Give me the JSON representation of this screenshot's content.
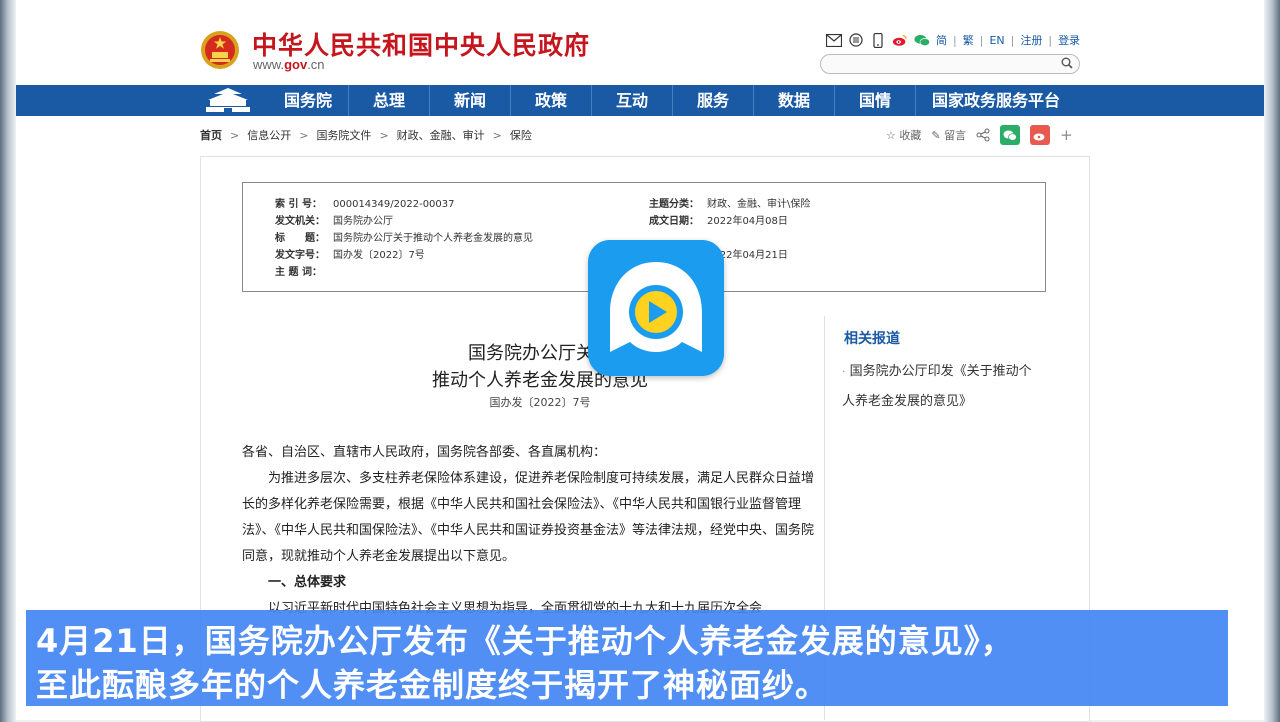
{
  "header": {
    "site_title": "中华人民共和国中央人民政府",
    "site_url_prefix": "www.",
    "site_url_brand": "gov",
    "site_url_suffix": ".cn",
    "tools": [
      "简",
      "繁",
      "EN",
      "注册",
      "登录"
    ],
    "tool_icons": [
      "mail-icon",
      "rss-icon",
      "mobile-icon",
      "weibo-icon",
      "wechat-icon"
    ],
    "search": {
      "placeholder": "",
      "value": ""
    }
  },
  "nav": {
    "items": [
      "国务院",
      "总理",
      "新闻",
      "政策",
      "互动",
      "服务",
      "数据",
      "国情",
      "国家政务服务平台"
    ]
  },
  "breadcrumb": [
    "首页",
    "信息公开",
    "国务院文件",
    "财政、金融、审计",
    "保险"
  ],
  "actions": {
    "favorite": "收藏",
    "comment": "留言"
  },
  "meta": {
    "index_no": {
      "label": "索 引 号：",
      "value": "000014349/2022-00037"
    },
    "issuer": {
      "label": "发文机关：",
      "value": "国务院办公厅"
    },
    "title": {
      "label": "标　　题：",
      "value": "国务院办公厅关于推动个人养老金发展的意见"
    },
    "doc_no": {
      "label": "发文字号：",
      "value": "国办发〔2022〕7号"
    },
    "subject": {
      "label": "主 题 词：",
      "value": ""
    },
    "category": {
      "label": "主题分类：",
      "value": "财政、金融、审计\\保险"
    },
    "created": {
      "label": "成文日期：",
      "value": "2022年04月08日"
    },
    "published": {
      "label": "",
      "value": "2022年04月21日"
    }
  },
  "document": {
    "title_line1": "国务院办公厅关于",
    "title_line2": "推动个人养老金发展的意见",
    "number": "国办发〔2022〕7号",
    "salutation": "各省、自治区、直辖市人民政府，国务院各部委、各直属机构：",
    "para1": "为推进多层次、多支柱养老保险体系建设，促进养老保险制度可持续发展，满足人民群众日益增长的多样化养老保险需要，根据《中华人民共和国社会保险法》、《中华人民共和国银行业监督管理法》、《中华人民共和国保险法》、《中华人民共和国证券投资基金法》等法律法规，经党中央、国务院同意，现就推动个人养老金发展提出以下意见。",
    "section1": "一、总体要求",
    "para2": "以习近平新时代中国特色社会主义思想为指导，全面贯彻党的十九大和十九届历次全会"
  },
  "related": {
    "title": "相关报道",
    "items": [
      "国务院办公厅印发《关于推动个人养老金发展的意见》"
    ]
  },
  "subtitle": {
    "line1": "4月21日，国务院办公厅发布《关于推动个人养老金发展的意见》，",
    "line2": "至此酝酿多年的个人养老金制度终于揭开了神秘面纱。"
  },
  "colors": {
    "brand_red": "#c4161c",
    "nav_blue": "#1a5aa5",
    "subtitle_bg": "#4285f4",
    "app_blue": "#1b9cef"
  }
}
